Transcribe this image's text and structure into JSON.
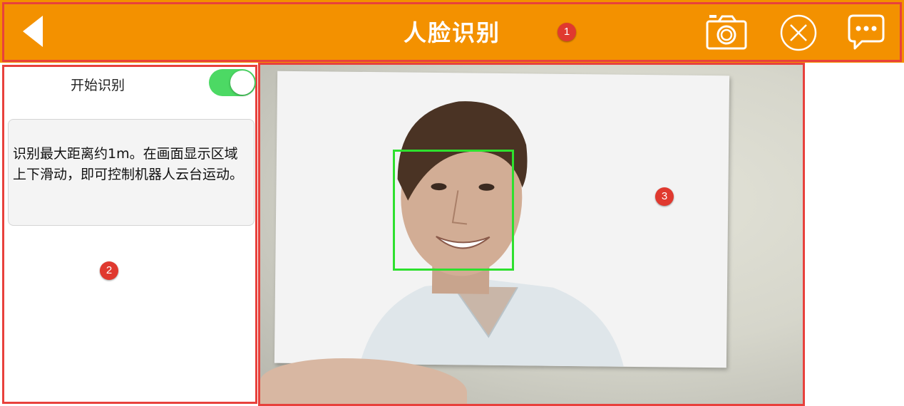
{
  "header": {
    "title": "人脸识别",
    "background_color": "#f39100",
    "back_icon": "back-arrow-icon",
    "camera_icon": "camera-icon",
    "close_icon": "close-circle-icon",
    "chat_icon": "chat-bubble-icon"
  },
  "left_panel": {
    "toggle_label": "开始识别",
    "toggle_on": true,
    "toggle_color": "#4cd964",
    "info_text": "识别最大距离约1m。在画面显示区域上下滑动，即可控制机器人云台运动。"
  },
  "camera": {
    "face_box_color": "#2ee02e"
  },
  "annotations": {
    "header_number": "1",
    "left_panel_number": "2",
    "camera_number": "3",
    "outline_color": "#e8413c"
  }
}
